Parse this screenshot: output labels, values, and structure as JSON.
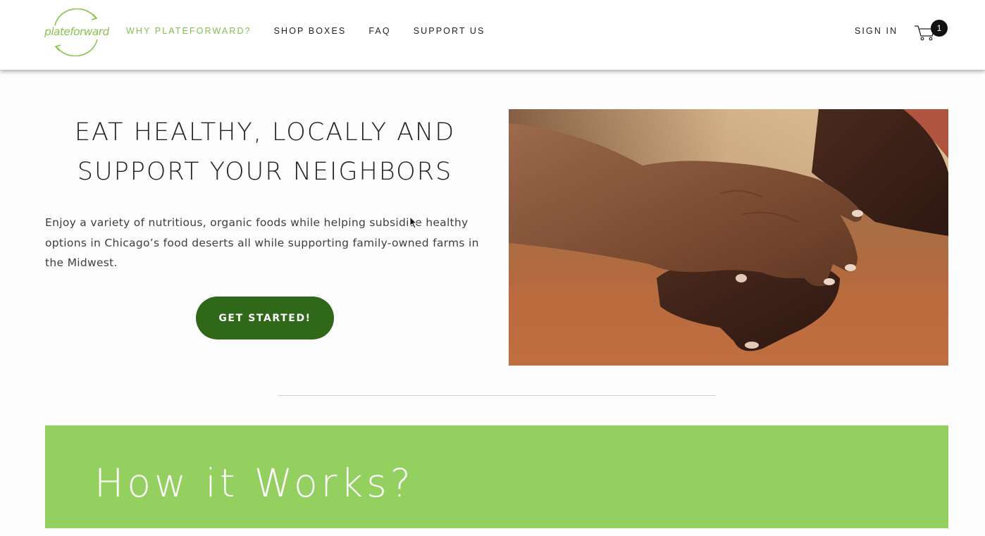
{
  "header": {
    "logo_text": "plateforward",
    "nav": [
      {
        "label": "WHY PLATEFORWARD?",
        "active": true
      },
      {
        "label": "SHOP BOXES",
        "active": false
      },
      {
        "label": "FAQ",
        "active": false
      },
      {
        "label": "SUPPORT US",
        "active": false
      }
    ],
    "sign_in": "SIGN IN",
    "cart_icon": "cart-icon",
    "cart_count": "1"
  },
  "hero": {
    "title_line1": "EAT HEALTHY, LOCALLY AND",
    "title_line2": "SUPPORT YOUR NEIGHBORS",
    "body": "Enjoy a variety of nutritious, organic foods while helping subsidize healthy options in Chicago’s food deserts all while supporting family-owned farms in the Midwest.",
    "cta_label": "GET STARTED!",
    "image": "holding-hands-photo"
  },
  "how_it_works": {
    "title": "How it Works?"
  },
  "colors": {
    "brand_green": "#88c54f",
    "nav_active": "#7fbf4f",
    "cta_green": "#2f6819",
    "banner_green": "#94d060"
  }
}
